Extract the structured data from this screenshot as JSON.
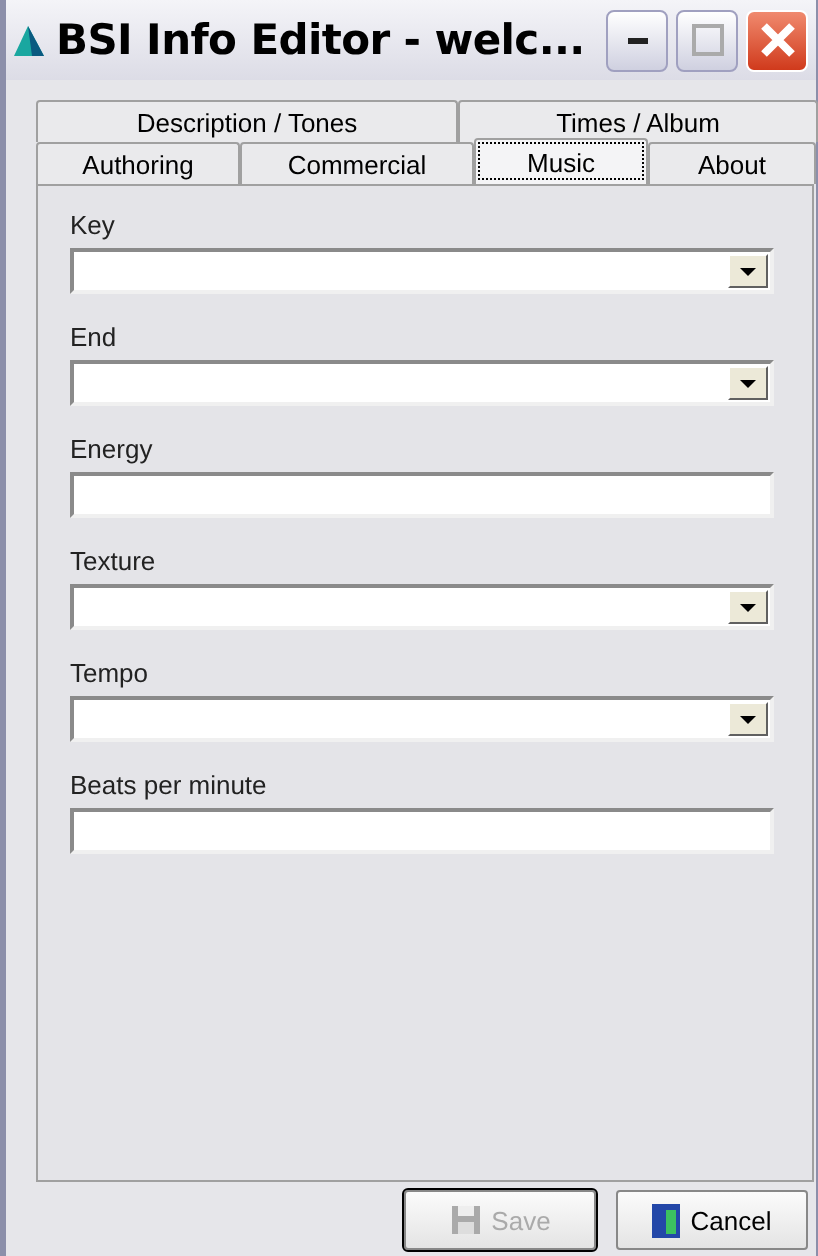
{
  "window": {
    "title": "BSI Info Editor - welc..."
  },
  "tab_rows": [
    [
      {
        "label": "Description / Tones",
        "selected": false
      },
      {
        "label": "Times / Album",
        "selected": false
      }
    ],
    [
      {
        "label": "Authoring",
        "selected": false
      },
      {
        "label": "Commercial",
        "selected": false
      },
      {
        "label": "Music",
        "selected": true
      },
      {
        "label": "About",
        "selected": false
      }
    ]
  ],
  "fields": [
    {
      "label": "Key",
      "kind": "combo"
    },
    {
      "label": "End",
      "kind": "combo"
    },
    {
      "label": "Energy",
      "kind": "text"
    },
    {
      "label": "Texture",
      "kind": "combo"
    },
    {
      "label": "Tempo",
      "kind": "combo"
    },
    {
      "label": "Beats per minute",
      "kind": "text"
    }
  ],
  "buttons": [
    {
      "label": "Save",
      "kind": "save",
      "disabled": true
    },
    {
      "label": "Cancel",
      "kind": "cancel",
      "disabled": false
    }
  ]
}
